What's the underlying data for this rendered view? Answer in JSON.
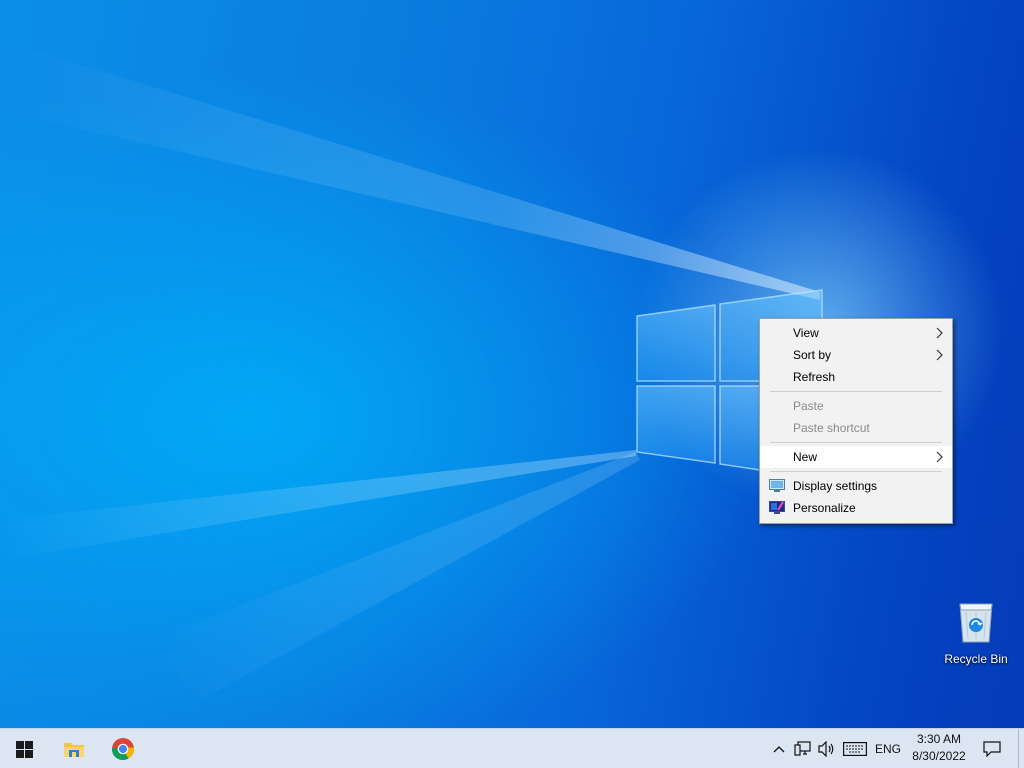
{
  "desktop": {
    "icons": [
      {
        "label": "Recycle Bin",
        "icon": "recycle-bin-icon"
      }
    ]
  },
  "context_menu": {
    "groups": [
      [
        {
          "label": "View",
          "submenu": true,
          "enabled": true
        },
        {
          "label": "Sort by",
          "submenu": true,
          "enabled": true
        },
        {
          "label": "Refresh",
          "submenu": false,
          "enabled": true
        }
      ],
      [
        {
          "label": "Paste",
          "submenu": false,
          "enabled": false
        },
        {
          "label": "Paste shortcut",
          "submenu": false,
          "enabled": false
        }
      ],
      [
        {
          "label": "New",
          "submenu": true,
          "enabled": true,
          "highlighted": true
        }
      ],
      [
        {
          "label": "Display settings",
          "icon": "display-settings-icon",
          "enabled": true
        },
        {
          "label": "Personalize",
          "icon": "personalize-icon",
          "enabled": true
        }
      ]
    ]
  },
  "taskbar": {
    "start_icon": "windows-logo-icon",
    "pinned": [
      {
        "name": "File Explorer",
        "icon": "file-explorer-icon"
      },
      {
        "name": "Google Chrome",
        "icon": "chrome-icon"
      }
    ],
    "tray": {
      "language": "ENG",
      "time": "3:30 AM",
      "date": "8/30/2022"
    }
  },
  "colors": {
    "wallpaper_blue": "#0a7de0",
    "taskbar_bg": "#dce6f2",
    "menu_bg": "#f2f2f2",
    "menu_disabled_text": "#8a8a8a"
  }
}
